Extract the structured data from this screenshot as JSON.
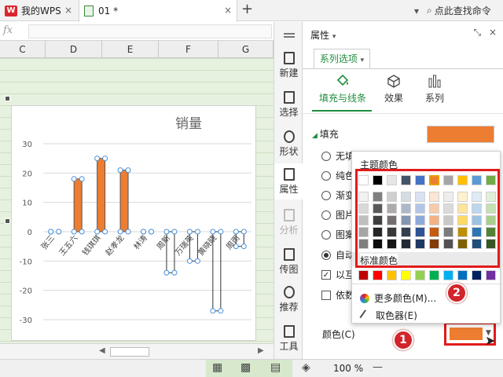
{
  "tabs": {
    "home_label": "我的WPS",
    "doc_label": "01 *",
    "add_symbol": "+",
    "close_symbol": "×"
  },
  "search": {
    "label": "点此查找命令"
  },
  "formula": {
    "fx": "fx"
  },
  "sheet": {
    "columns": [
      "C",
      "D",
      "E",
      "F",
      "G"
    ]
  },
  "chart_data": {
    "type": "bar",
    "title": "销量",
    "categories": [
      "张三",
      "王五六",
      "钱琪琪",
      "赵孝龙",
      "林涛",
      "周新",
      "万瑞英",
      "黄晓晓",
      "周雨"
    ],
    "values": [
      0,
      18,
      25,
      21,
      0,
      -14,
      -10,
      -27,
      -5
    ],
    "ylim": [
      -30,
      30
    ],
    "yticks": [
      30,
      20,
      10,
      0,
      -10,
      -20,
      -30
    ],
    "bar_color": "#ed7d31",
    "grid": true,
    "legend": "none"
  },
  "sidestrip": {
    "items": [
      {
        "label": "新建",
        "icon": "new-icon"
      },
      {
        "label": "选择",
        "icon": "select-icon"
      },
      {
        "label": "形状",
        "icon": "shape-icon"
      },
      {
        "label": "属性",
        "icon": "property-icon"
      },
      {
        "label": "分析",
        "icon": "analysis-icon"
      },
      {
        "label": "传图",
        "icon": "upload-image-icon"
      },
      {
        "label": "推荐",
        "icon": "recommend-icon"
      },
      {
        "label": "工具",
        "icon": "toolbox-icon"
      }
    ]
  },
  "panel": {
    "title": "属性",
    "series_tab": "系列选项",
    "tabs": [
      {
        "label": "填充与线条",
        "icon": "fill-bucket-icon"
      },
      {
        "label": "效果",
        "icon": "cube-icon"
      },
      {
        "label": "系列",
        "icon": "bar-chart-icon"
      }
    ],
    "fill_section": "填充",
    "fill_color": "#ed7d31",
    "options": [
      {
        "label": "无填",
        "kind": "radio",
        "checked": false
      },
      {
        "label": "纯色",
        "kind": "radio",
        "checked": false
      },
      {
        "label": "渐变",
        "kind": "radio",
        "checked": false
      },
      {
        "label": "图片",
        "kind": "radio",
        "checked": false
      },
      {
        "label": "图案",
        "kind": "radio",
        "checked": false
      },
      {
        "label": "自动",
        "kind": "radio",
        "checked": true
      },
      {
        "label": "以互",
        "kind": "checkbox",
        "checked": true
      },
      {
        "label": "依数",
        "kind": "checkbox",
        "checked": false
      }
    ],
    "color_label": "颜色(C)"
  },
  "palette": {
    "theme_title": "主题颜色",
    "standard_title": "标准颜色",
    "more_colors": "更多颜色(M)...",
    "picker": "取色器(E)",
    "theme_top": [
      "#ffffff",
      "#000000",
      "#e7e6e6",
      "#44546a",
      "#4472c4",
      "#ed7d31",
      "#a5a5a5",
      "#ffc000",
      "#5b9bd5",
      "#70ad47"
    ],
    "theme_shades": [
      [
        "#f2f2f2",
        "#7f7f7f",
        "#d0cece",
        "#d6dce4",
        "#d9e2f3",
        "#fbe5d5",
        "#ededed",
        "#fff2cc",
        "#deebf6",
        "#e2efd9"
      ],
      [
        "#d9d9d9",
        "#595959",
        "#aeaaaa",
        "#adb9ca",
        "#b4c6e7",
        "#f7cbac",
        "#dbdbdb",
        "#fee599",
        "#bdd7ee",
        "#c5e0b3"
      ],
      [
        "#bfbfbf",
        "#3f3f3f",
        "#757070",
        "#8496b0",
        "#8eaadb",
        "#f4b183",
        "#c9c9c9",
        "#ffd965",
        "#9cc3e5",
        "#a8d08d"
      ],
      [
        "#a5a5a5",
        "#262626",
        "#3a3838",
        "#323f4f",
        "#2f5496",
        "#c55a11",
        "#7b7b7b",
        "#bf8f00",
        "#2e75b5",
        "#538135"
      ],
      [
        "#7f7f7f",
        "#0c0c0c",
        "#171616",
        "#222a35",
        "#1f3864",
        "#833c0b",
        "#525252",
        "#7f6000",
        "#1e4e79",
        "#375623"
      ]
    ],
    "standard": [
      "#c00000",
      "#ff0000",
      "#ffc000",
      "#ffff00",
      "#92d050",
      "#00b050",
      "#00b0f0",
      "#0070c0",
      "#002060",
      "#7030a0"
    ]
  },
  "status": {
    "zoom": "100 %"
  },
  "badges": {
    "one": "1",
    "two": "2"
  }
}
